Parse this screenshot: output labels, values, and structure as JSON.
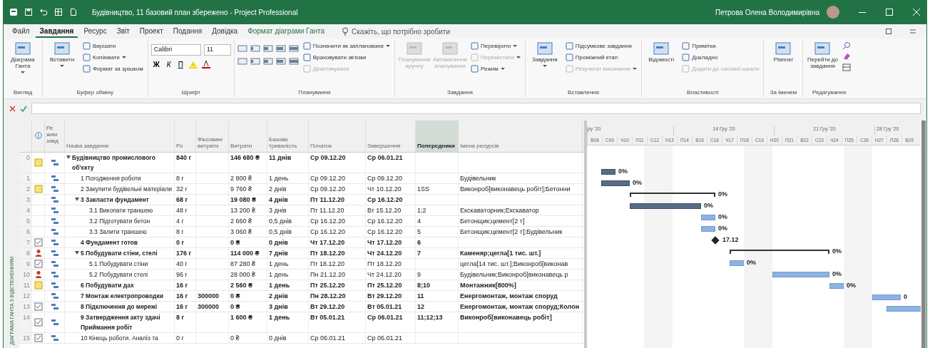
{
  "window": {
    "title": "Будівництво, 11 базовий план збережено - Project Professional",
    "user": "Петрова Олена Володимирівна"
  },
  "tabs": [
    {
      "label": "Файл",
      "kind": "plain",
      "selected": false
    },
    {
      "label": "Завдання",
      "kind": "plain",
      "selected": true
    },
    {
      "label": "Ресурс",
      "kind": "plain",
      "selected": false
    },
    {
      "label": "Звіт",
      "kind": "plain",
      "selected": false
    },
    {
      "label": "Проект",
      "kind": "plain",
      "selected": false
    },
    {
      "label": "Подання",
      "kind": "plain",
      "selected": false
    },
    {
      "label": "Довідка",
      "kind": "plain",
      "selected": false
    },
    {
      "label": "Формат діаграми Ганта",
      "kind": "contextual",
      "selected": false
    }
  ],
  "search": {
    "placeholder": "Скажіть, що потрібно зробити"
  },
  "ribbon": [
    {
      "label": "Вигляд",
      "kind": "items",
      "items": [
        {
          "kind": "large",
          "label": "Діаграма Ганта",
          "dropdown": true,
          "disabled": false
        }
      ]
    },
    {
      "label": "Буфер обміну",
      "kind": "items",
      "items": [
        {
          "kind": "large",
          "label": "Вставити",
          "dropdown": true,
          "disabled": false
        },
        {
          "kind": "small",
          "label": "Вирізати",
          "dropdown": false,
          "disabled": false
        },
        {
          "kind": "small",
          "label": "Копіювати",
          "dropdown": true,
          "disabled": false
        },
        {
          "kind": "small",
          "label": "Формат за зразком",
          "dropdown": false,
          "disabled": false
        }
      ]
    },
    {
      "label": "Шрифт",
      "kind": "font",
      "font": "Calibri",
      "size": "11",
      "styles": [
        "Ж",
        "К",
        "П"
      ]
    },
    {
      "label": "Планування",
      "kind": "items",
      "items": [
        {
          "kind": "grid"
        },
        {
          "kind": "small",
          "label": "Позначити як заплановане",
          "dropdown": true,
          "disabled": false
        },
        {
          "kind": "small",
          "label": "Враховувати зв'язки",
          "dropdown": false,
          "disabled": false
        },
        {
          "kind": "small",
          "label": "Деактивувати",
          "dropdown": false,
          "disabled": true
        }
      ]
    },
    {
      "label": "Завдання",
      "kind": "items",
      "items": [
        {
          "kind": "large",
          "label": "Планування вручну",
          "dropdown": false,
          "disabled": true
        },
        {
          "kind": "large",
          "label": "Автоматичне планування",
          "dropdown": false,
          "disabled": true
        },
        {
          "kind": "small",
          "label": "Перевірити",
          "dropdown": true,
          "disabled": false
        },
        {
          "kind": "small",
          "label": "Перемістити",
          "dropdown": true,
          "disabled": true
        },
        {
          "kind": "small",
          "label": "Режим",
          "dropdown": true,
          "disabled": false
        }
      ]
    },
    {
      "label": "Вставлення",
      "kind": "items",
      "items": [
        {
          "kind": "large",
          "label": "Завдання",
          "dropdown": true,
          "disabled": false
        },
        {
          "kind": "small",
          "label": "Підсумкове завдання",
          "dropdown": false,
          "disabled": false
        },
        {
          "kind": "small",
          "label": "Проміжний етап",
          "dropdown": false,
          "disabled": false
        },
        {
          "kind": "small",
          "label": "Результат виконання",
          "dropdown": true,
          "disabled": true
        }
      ]
    },
    {
      "label": "Властивості",
      "kind": "items",
      "items": [
        {
          "kind": "large",
          "label": "Відомості",
          "dropdown": false,
          "disabled": false
        },
        {
          "kind": "small",
          "label": "Примітки",
          "dropdown": false,
          "disabled": false
        },
        {
          "kind": "small",
          "label": "Докладно",
          "dropdown": false,
          "disabled": false
        },
        {
          "kind": "small",
          "label": "Додати до часової шкали",
          "dropdown": false,
          "disabled": true
        }
      ]
    },
    {
      "label": "За іменем",
      "kind": "items",
      "items": [
        {
          "kind": "large",
          "label": "Planner",
          "dropdown": false,
          "disabled": false
        }
      ]
    },
    {
      "label": "Редагування",
      "kind": "items",
      "items": [
        {
          "kind": "large",
          "label": "Перейти до завдання",
          "dropdown": false,
          "disabled": false
        },
        {
          "kind": "icons"
        }
      ]
    }
  ],
  "view_label": "ДІАГРАМА ГАНТА З ВІДСТЕЖЕННЯМ",
  "table": {
    "columns": [
      {
        "kind": "id",
        "selected": false
      },
      {
        "kind": "info",
        "selected": false
      },
      {
        "label": "Ре жим завд",
        "kind": "mode",
        "selected": false
      },
      {
        "label": "Назва завдання",
        "kind": "name",
        "selected": false
      },
      {
        "label": "Ро",
        "kind": "work",
        "selected": false
      },
      {
        "label": "Фіксовані витрати",
        "kind": "fixed",
        "selected": false
      },
      {
        "label": "Витрати",
        "kind": "cost",
        "selected": false
      },
      {
        "label": "Базова тривалість",
        "kind": "duration",
        "selected": false
      },
      {
        "label": "Початок",
        "kind": "start",
        "selected": false
      },
      {
        "label": "Завершення",
        "kind": "finish",
        "selected": false
      },
      {
        "label": "Попередники",
        "kind": "pred",
        "selected": true
      },
      {
        "label": "Імена ресурсів",
        "kind": "res",
        "selected": false
      }
    ],
    "rows": [
      {
        "id": "0",
        "indicators": [
          {
            "kind": "note"
          }
        ],
        "kind": "summary",
        "expanded": true,
        "name": "Будівництво промислового об'єкту",
        "work": "840 г",
        "cost": "146 680 ₴",
        "duration": "11 днів",
        "start": "Ср 09.12.20",
        "finish": "Ср 06.01.21",
        "bold": true,
        "children": [
          {
            "id": "1",
            "kind": "task",
            "name": "1 Погодження роботи",
            "work": "8 г",
            "cost": "2 800 ₴",
            "duration": "1 день",
            "start": "Ср 09.12.20",
            "finish": "Ср 09.12.20",
            "res": "Будівельник",
            "bold": false,
            "bar": {
              "label": "0%",
              "critical": true
            }
          },
          {
            "id": "2",
            "indicators": [
              {
                "kind": "note"
              }
            ],
            "kind": "task",
            "name": "2 Закупити будівельні матеріали",
            "work": "32 г",
            "cost": "9 760 ₴",
            "duration": "2 днів",
            "start": "Ср 09.12.20",
            "finish": "Чт 10.12.20",
            "pred": "1SS",
            "res": "Виконроб[виконавець робіт];Бетонни",
            "bold": false,
            "bar": {
              "label": "0%",
              "critical": true
            }
          },
          {
            "id": "3",
            "kind": "summary",
            "expanded": true,
            "name": "3 Закласти фундамент",
            "work": "68 г",
            "cost": "19 080 ₴",
            "duration": "4 днів",
            "start": "Пт 11.12.20",
            "finish": "Ср 16.12.20",
            "bold": true,
            "bar": {
              "label": "0%"
            },
            "children": [
              {
                "id": "4",
                "kind": "task",
                "name": "3.1 Викопати траншею",
                "work": "48 г",
                "cost": "13 200 ₴",
                "duration": "3 днів",
                "start": "Пт 11.12.20",
                "finish": "Вт 15.12.20",
                "pred": "1;2",
                "res": "Екскаваторник;Екскаватор",
                "bold": false,
                "bar": {
                  "label": "0%",
                  "critical": true
                }
              },
              {
                "id": "5",
                "kind": "task",
                "name": "3.2 Підготувати бетон",
                "work": "4 г",
                "cost": "2 660 ₴",
                "duration": "0,5 днів",
                "start": "Ср 16.12.20",
                "finish": "Ср 16.12.20",
                "pred": "4",
                "res": "Бетонщик;цемент[2 т]",
                "bold": false,
                "bar": {
                  "label": "0%",
                  "critical": false
                }
              },
              {
                "id": "6",
                "kind": "task",
                "name": "3.3 Залити траншею",
                "work": "8 г",
                "cost": "3 060 ₴",
                "duration": "0,5 днів",
                "start": "Ср 16.12.20",
                "finish": "Ср 16.12.20",
                "pred": "5",
                "res": "Бетонщик;цемент[2 т];Будівельник",
                "bold": false,
                "bar": {
                  "label": "0%",
                  "critical": false
                }
              }
            ]
          },
          {
            "id": "7",
            "indicators": [
              {
                "kind": "check"
              }
            ],
            "kind": "milestone",
            "name": "4 Фундамент готов",
            "work": "0 г",
            "cost": "0 ₴",
            "duration": "0 днів",
            "start": "Чт 17.12.20",
            "finish": "Чт 17.12.20",
            "pred": "6",
            "bold": true,
            "bar": {
              "label": "17.12"
            }
          },
          {
            "id": "8",
            "indicators": [
              {
                "kind": "person"
              }
            ],
            "kind": "summary",
            "expanded": true,
            "name": "5 Побудувати стіни, стелі",
            "work": "176 г",
            "cost": "114 000 ₴",
            "duration": "7 днів",
            "start": "Пт 18.12.20",
            "finish": "Чт 24.12.20",
            "pred": "7",
            "res": "Каменяр;цегла[1 тис. шт.]",
            "bold": true,
            "bar": {
              "label": "0%"
            },
            "children": [
              {
                "id": "9",
                "indicators": [
                  {
                    "kind": "check"
                  }
                ],
                "kind": "task",
                "name": "5.1 Побудувати стіни",
                "work": "40 г",
                "cost": "87 280 ₴",
                "duration": "1 день",
                "start": "Пт 18.12.20",
                "finish": "Пт 18.12.20",
                "res": "цегла[14 тис. шт.];Виконроб[виконав",
                "bold": false,
                "bar": {
                  "label": "0%",
                  "critical": false
                }
              },
              {
                "id": "10",
                "indicators": [
                  {
                    "kind": "person"
                  }
                ],
                "kind": "task",
                "name": "5.2 Побудувати стелі",
                "work": "96 г",
                "cost": "28 000 ₴",
                "duration": "1 день",
                "start": "Пн 21.12.20",
                "finish": "Чт 24.12.20",
                "pred": "9",
                "res": "Будівельник;Виконроб[виконавець р",
                "bold": false,
                "bar": {
                  "label": "0%",
                  "critical": false
                }
              }
            ]
          },
          {
            "id": "11",
            "indicators": [
              {
                "kind": "note"
              }
            ],
            "kind": "task",
            "name": "6 Побудувати дах",
            "work": "16 г",
            "cost": "2 560 ₴",
            "duration": "1 день",
            "start": "Пт 25.12.20",
            "finish": "Пт 25.12.20",
            "pred": "8;10",
            "res": "Монтажник[800%]",
            "bold": true,
            "bar": {
              "label": "0%",
              "critical": false
            }
          },
          {
            "id": "12",
            "kind": "task",
            "name": "7 Монтаж електропроводки",
            "work": "16 г",
            "fixed": "300000",
            "cost": "0 ₴",
            "duration": "2 днів",
            "start": "Пн 28.12.20",
            "finish": "Вт 29.12.20",
            "pred": "11",
            "res": "Енергомонтаж, монтаж споруд",
            "bold": true,
            "bar": {
              "label": "0",
              "critical": false
            }
          },
          {
            "id": "13",
            "indicators": [
              {
                "kind": "check"
              }
            ],
            "kind": "task",
            "name": "8 Підключення до мережі",
            "work": "16 г",
            "fixed": "300000",
            "cost": "0 ₴",
            "duration": "3 днів",
            "start": "Вт 29.12.20",
            "finish": "Вт 05.01.21",
            "pred": "12",
            "res": "Енергомонтаж, монтаж споруд;Колон",
            "bold": true,
            "bar": {
              "critical": false
            }
          },
          {
            "id": "14",
            "indicators": [
              {
                "kind": "check"
              }
            ],
            "kind": "task",
            "name": "9 Затвердження акту здачі Приймання робіт",
            "work": "8 г",
            "cost": "1 600 ₴",
            "duration": "1 день",
            "start": "Вт 05.01.21",
            "finish": "Ср 06.01.21",
            "pred": "11;12;13",
            "res": "Виконроб[виконавець робіт]",
            "bold": true
          },
          {
            "id": "15",
            "indicators": [
              {
                "kind": "check"
              }
            ],
            "kind": "milestone",
            "name": "10 Кінець роботи. Аналіз та",
            "work": "0 г",
            "cost": "0 ₴",
            "duration": "0 днів",
            "start": "Ср 06.01.21",
            "finish": "Ср 06.01.21",
            "bold": false
          }
        ]
      }
    ]
  },
  "timescale": {
    "weeks": [
      "ру '20",
      "14 Гру '20",
      "21 Гру '20",
      "28 Гру '20"
    ],
    "days": [
      "В08",
      "С09",
      "Ч10",
      "П11",
      "С12",
      "Н13",
      "П14",
      "В15",
      "С16",
      "Ч17",
      "П18",
      "С19",
      "Н20",
      "П21",
      "В22",
      "С23",
      "Ч24",
      "П25",
      "С26",
      "Н27",
      "П28",
      "В29"
    ]
  }
}
